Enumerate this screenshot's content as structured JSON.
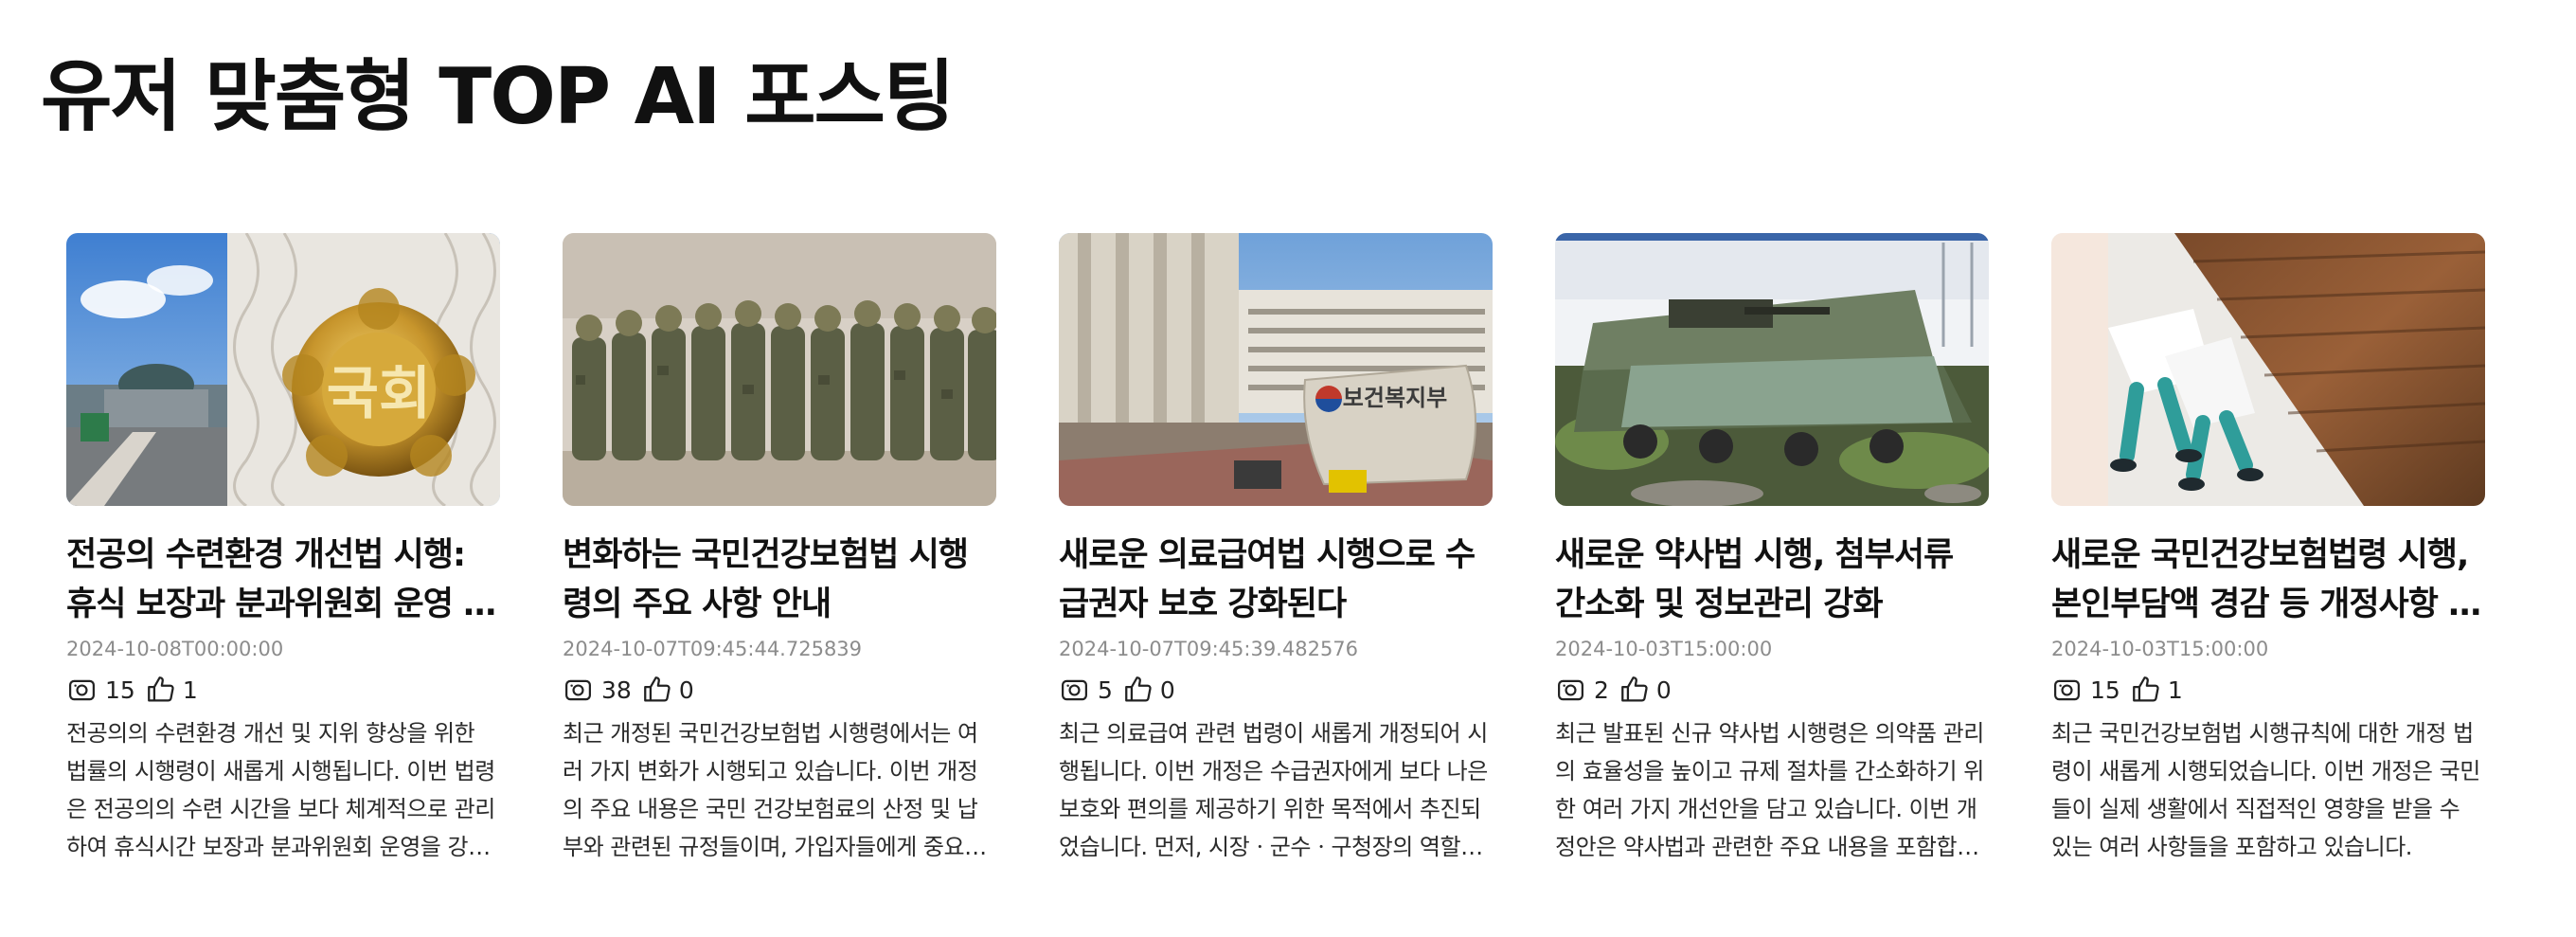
{
  "section": {
    "title": "유저 맞춤형 TOP AI 포스팅"
  },
  "icons": {
    "views": "view-camera-icon",
    "likes": "thumbs-up-icon"
  },
  "posts": [
    {
      "title": "전공의 수련환경 개선법 시행: 휴식 보장과 분과위원회 운영 강화",
      "date": "2024-10-08T00:00:00",
      "views": "15",
      "likes": "1",
      "summary": "전공의의 수련환경 개선 및 지위 향상을 위한 법률의 시행령이 새롭게 시행됩니다. 이번 법령은 전공의의 수련 시간을 보다 체계적으로 관리하여 휴식시간 보장과 분과위원회 운영을 강화하는 내용을 담고 있습니다.",
      "image": "national-assembly-emblem-photo"
    },
    {
      "title": "변화하는 국민건강보험법 시행령의 주요 사항 안내",
      "date": "2024-10-07T09:45:44.725839",
      "views": "38",
      "likes": "0",
      "summary": "최근 개정된 국민건강보험법 시행령에서는 여러 가지 변화가 시행되고 있습니다. 이번 개정의 주요 내용은 국민 건강보험료의 산정 및 납부와 관련된 규정들이며, 가입자들에게 중요한 영향을 미칩니다.",
      "image": "soldiers-lineup-photo"
    },
    {
      "title": "새로운 의료급여법 시행으로 수급권자 보호 강화된다",
      "date": "2024-10-07T09:45:39.482576",
      "views": "5",
      "likes": "0",
      "summary": "최근 의료급여 관련 법령이 새롭게 개정되어 시행됩니다. 이번 개정은 수급권자에게 보다 나은 보호와 편의를 제공하기 위한 목적에서 추진되었습니다. 먼저, 시장ㆍ군수ㆍ구청장의 역할이 강화됩니다.",
      "image": "ministry-of-health-building-photo",
      "sign_text": "보건복지부"
    },
    {
      "title": "새로운 약사법 시행, 첨부서류 간소화 및 정보관리 강화",
      "date": "2024-10-03T15:00:00",
      "views": "2",
      "likes": "0",
      "summary": "최근 발표된 신규 약사법 시행령은 의약품 관리의 효율성을 높이고 규제 절차를 간소화하기 위한 여러 가지 개선안을 담고 있습니다. 이번 개정안은 약사법과 관련한 주요 내용을 포함합니다.",
      "image": "armored-vehicle-exhibition-photo"
    },
    {
      "title": "새로운 국민건강보험법령 시행, 본인부담액 경감 등 개정사항 안내",
      "date": "2024-10-03T15:00:00",
      "views": "15",
      "likes": "1",
      "summary": "최근 국민건강보험법 시행규칙에 대한 개정 법령이 새롭게 시행되었습니다. 이번 개정은 국민들이 실제 생활에서 직접적인 영향을 받을 수 있는 여러 사항들을 포함하고 있습니다.",
      "image": "medical-staff-walking-photo"
    }
  ]
}
